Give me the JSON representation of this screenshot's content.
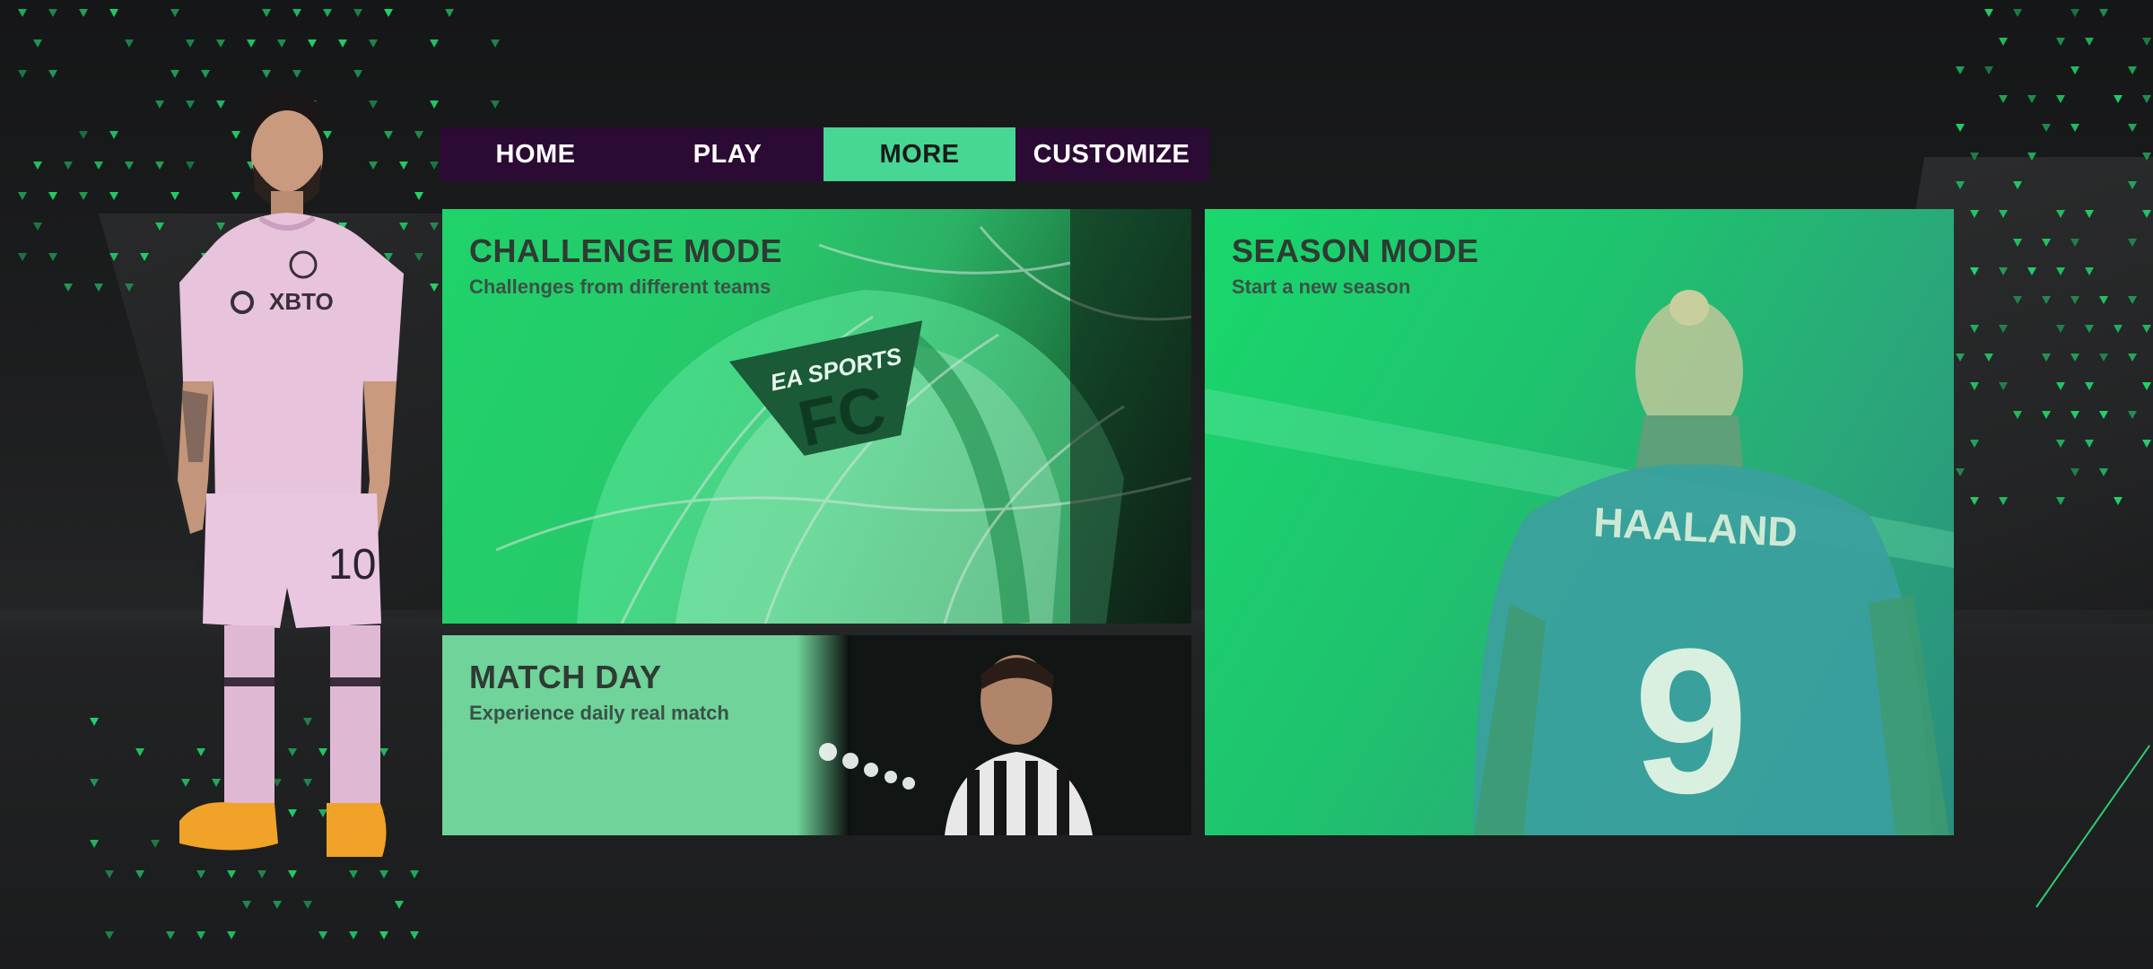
{
  "tabs": [
    {
      "label": "HOME",
      "active": false
    },
    {
      "label": "PLAY",
      "active": false
    },
    {
      "label": "MORE",
      "active": true
    },
    {
      "label": "CUSTOMIZE",
      "active": false
    }
  ],
  "cards": {
    "challenge": {
      "title": "CHALLENGE MODE",
      "subtitle": "Challenges from different teams",
      "logo_text_top": "EA SPORTS",
      "logo_text_main": "FC"
    },
    "matchday": {
      "title": "MATCH DAY",
      "subtitle": "Experience daily real match"
    },
    "season": {
      "title": "SEASON MODE",
      "subtitle": "Start a new season",
      "jersey_name": "HAALAND",
      "jersey_number": "9"
    }
  },
  "player": {
    "sponsor": "XBTO",
    "shorts_number": "10"
  },
  "colors": {
    "accent": "#47d693",
    "tab_bg": "#2b0a34",
    "dot_green": "#22d66b"
  }
}
